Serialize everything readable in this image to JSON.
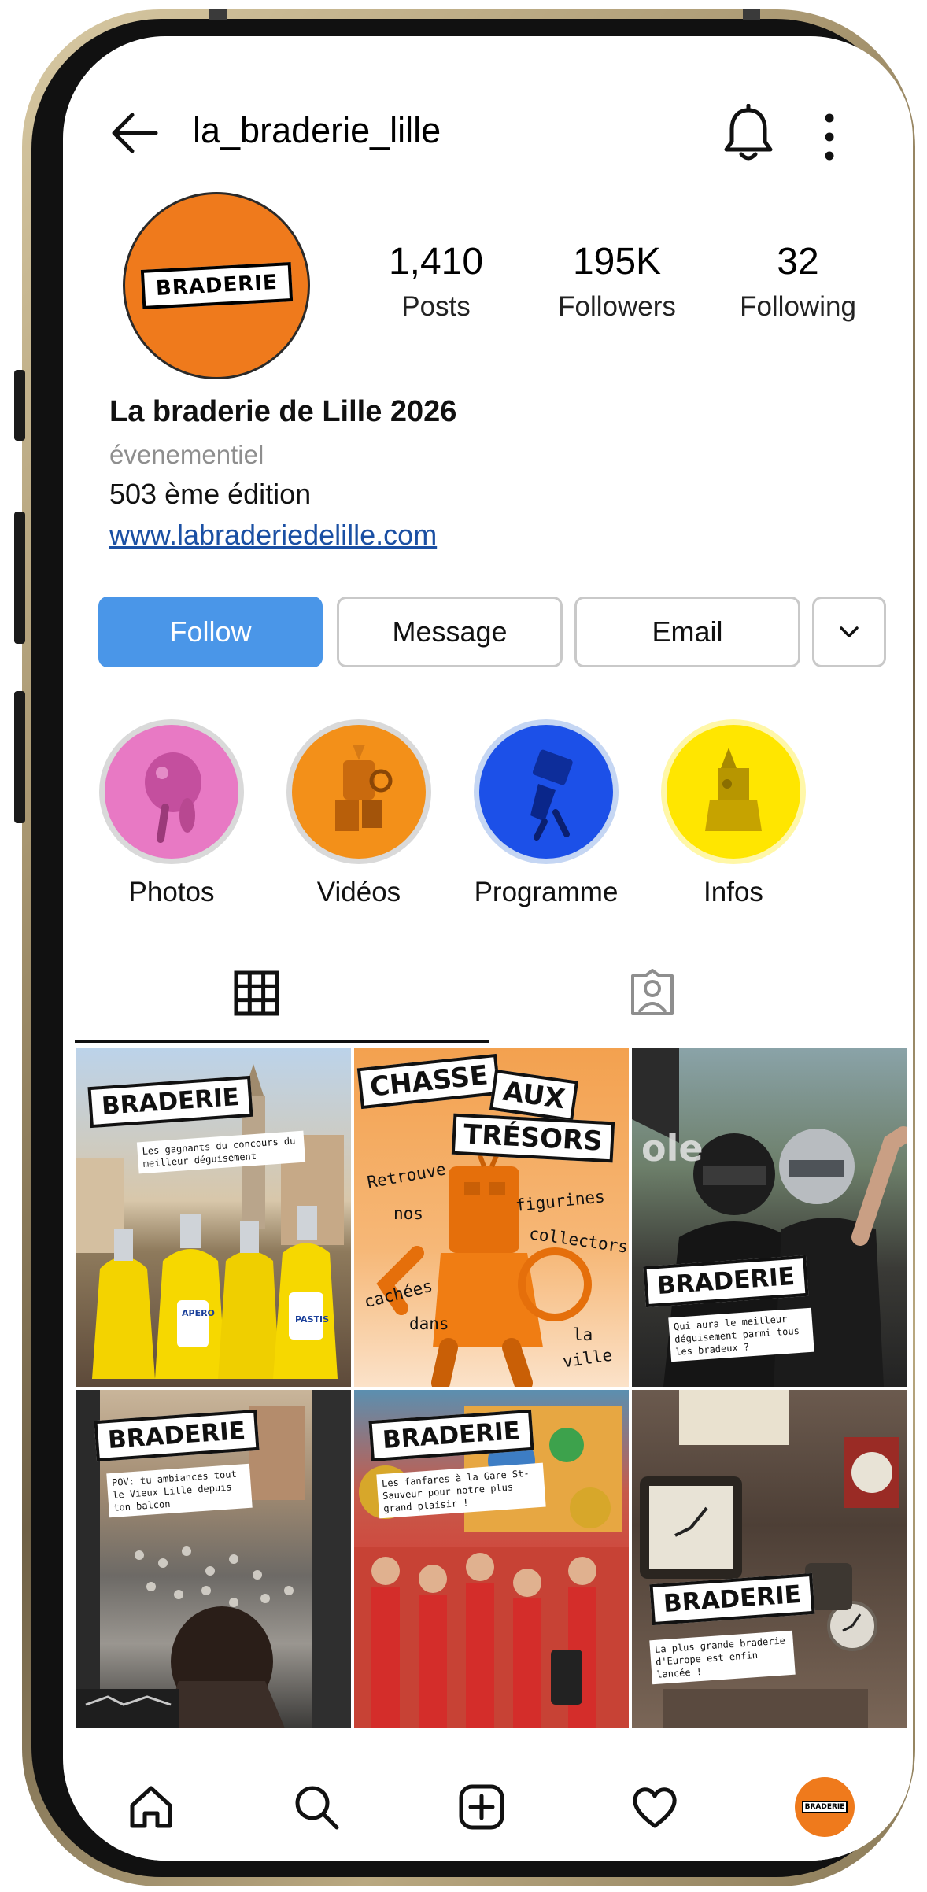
{
  "header": {
    "username": "la_braderie_lille"
  },
  "profile": {
    "avatar_logo": "BRADERIE",
    "stats": [
      {
        "value": "1,410",
        "label": "Posts"
      },
      {
        "value": "195K",
        "label": "Followers"
      },
      {
        "value": "32",
        "label": "Following"
      }
    ],
    "name": "La braderie de Lille 2026",
    "category": "évenementiel",
    "description": "503 ème édition",
    "link": "www.labraderiedelille.com"
  },
  "actions": {
    "follow": "Follow",
    "message": "Message",
    "email": "Email"
  },
  "highlights": [
    {
      "label": "Photos",
      "color": "#e879c4"
    },
    {
      "label": "Vidéos",
      "color": "#f39019"
    },
    {
      "label": "Programme",
      "color": "#1c50e8"
    },
    {
      "label": "Infos",
      "color": "#ffe600"
    }
  ],
  "posts": [
    {
      "tag": "BRADERIE",
      "caption": "Les gagnants du concours du meilleur déguisement",
      "labels": [
        "APERO",
        "PASTIS"
      ]
    },
    {
      "title1": "CHASSE",
      "title2": "AUX",
      "title3": "TRÉSORS",
      "words": [
        "Retrouve",
        "nos",
        "figurines",
        "collectors",
        "cachées",
        "dans",
        "la",
        "ville"
      ]
    },
    {
      "tag": "BRADERIE",
      "caption": "Qui aura le meilleur déguisement parmi tous les bradeux ?",
      "store_sign": "ole"
    },
    {
      "tag": "BRADERIE",
      "caption": "POV: tu ambiances tout le Vieux Lille depuis ton balcon"
    },
    {
      "tag": "BRADERIE",
      "caption": "Les fanfares à la Gare St-Sauveur pour notre plus grand plaisir !"
    },
    {
      "tag": "BRADERIE",
      "caption": "La plus grande braderie d'Europe est enfin lancée !"
    }
  ],
  "colors": {
    "follow_button": "#4a96e8",
    "brand_orange": "#ef7a1c",
    "link": "#1a4fa3"
  },
  "icons": [
    "back-arrow-icon",
    "bell-icon",
    "more-vertical-icon",
    "grid-icon",
    "tagged-icon",
    "home-icon",
    "search-icon",
    "create-icon",
    "heart-icon"
  ]
}
